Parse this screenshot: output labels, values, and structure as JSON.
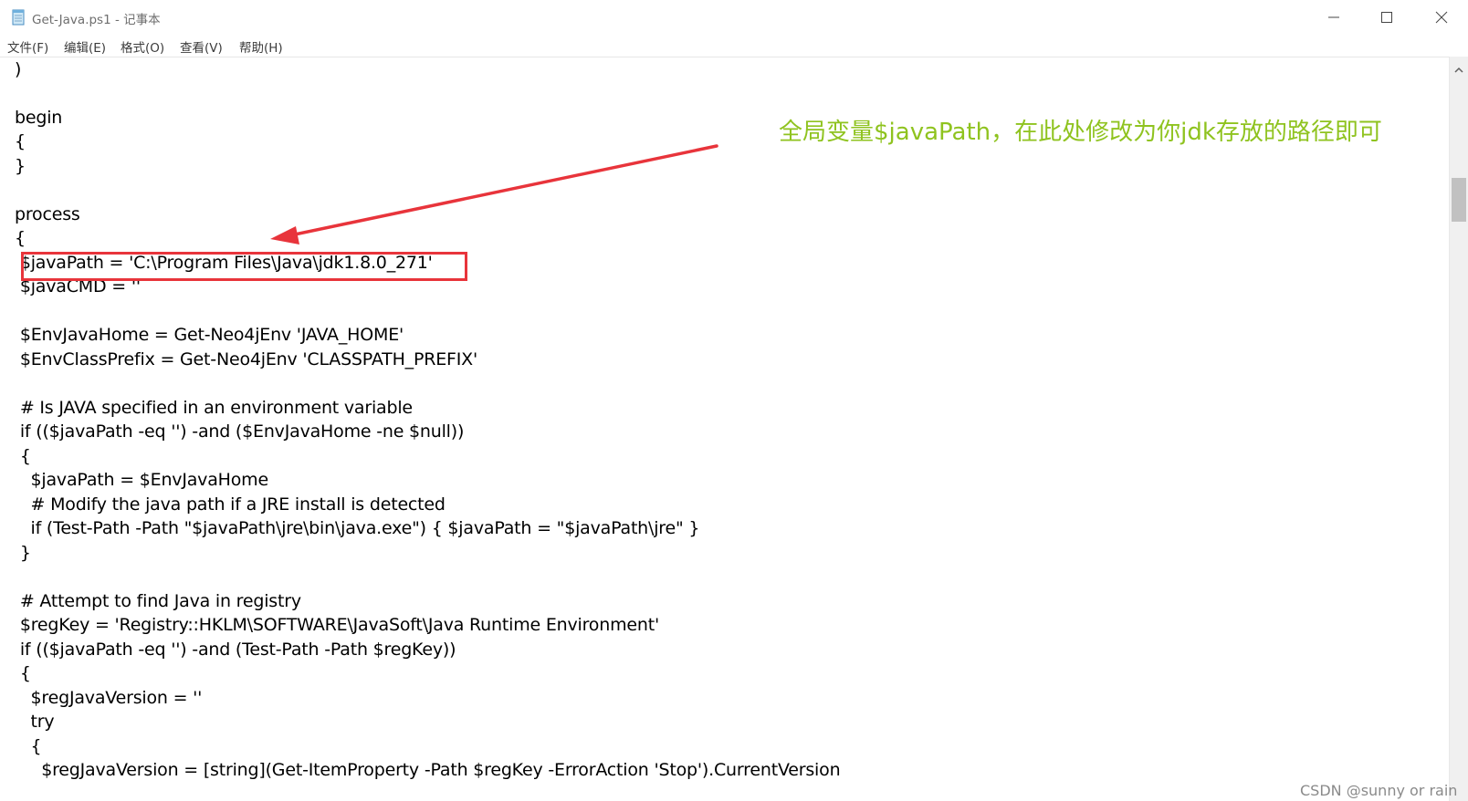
{
  "window": {
    "title": "Get-Java.ps1 - 记事本"
  },
  "menu": {
    "file": "文件(F)",
    "edit": "编辑(E)",
    "format": "格式(O)",
    "view": "查看(V)",
    "help": "帮助(H)"
  },
  "editor": {
    "lines": [
      ")",
      "",
      "begin",
      "{",
      "}",
      "",
      "process",
      "{",
      " $javaPath = 'C:\\Program Files\\Java\\jdk1.8.0_271'",
      " $javaCMD = ''",
      "",
      " $EnvJavaHome = Get-Neo4jEnv 'JAVA_HOME'",
      " $EnvClassPrefix = Get-Neo4jEnv 'CLASSPATH_PREFIX'",
      "",
      " # Is JAVA specified in an environment variable",
      " if (($javaPath -eq '') -and ($EnvJavaHome -ne $null))",
      " {",
      "   $javaPath = $EnvJavaHome",
      "   # Modify the java path if a JRE install is detected",
      "   if (Test-Path -Path \"$javaPath\\jre\\bin\\java.exe\") { $javaPath = \"$javaPath\\jre\" }",
      " }",
      "",
      " # Attempt to find Java in registry",
      " $regKey = 'Registry::HKLM\\SOFTWARE\\JavaSoft\\Java Runtime Environment'",
      " if (($javaPath -eq '') -and (Test-Path -Path $regKey))",
      " {",
      "   $regJavaVersion = ''",
      "   try",
      "   {",
      "     $regJavaVersion = [string](Get-ItemProperty -Path $regKey -ErrorAction 'Stop').CurrentVersion"
    ]
  },
  "annotation": {
    "text": "全局变量$javaPath，在此处修改为你jdk存放的路径即可",
    "text_color": "#8fc31f",
    "box_color": "#e8343b"
  },
  "watermark": "CSDN @sunny or rain",
  "colors": {
    "background": "#ffffff",
    "text": "#000000",
    "scrollbar_track": "#f0f0f0",
    "scrollbar_thumb": "#c1c1c1"
  },
  "icons": {
    "app": "notepad-icon",
    "minimize": "minimize-icon",
    "maximize": "maximize-icon",
    "close": "close-icon",
    "scroll_up": "chevron-up-icon"
  }
}
